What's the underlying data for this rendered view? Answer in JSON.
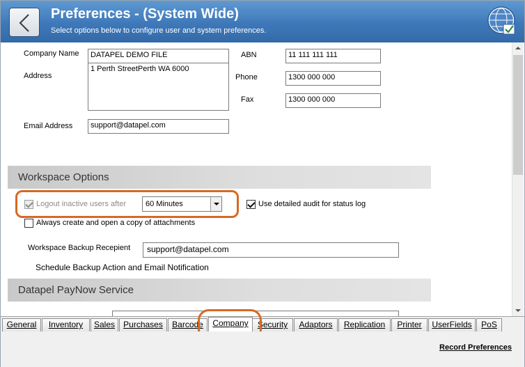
{
  "header": {
    "title": "Preferences - (System Wide)",
    "subtitle": "Select options below to configure user and system preferences."
  },
  "company": {
    "company_name_label": "Company Name",
    "company_name_value": "DATAPEL DEMO FILE",
    "address_label": "Address",
    "address_value": "1 Perth StreetPerth WA 6000",
    "email_label": "Email Address",
    "email_value": "support@datapel.com",
    "abn_label": "ABN",
    "abn_value": "11 111 111 111",
    "phone_label": "Phone",
    "phone_value": "1300 000 000",
    "fax_label": "Fax",
    "fax_value": "1300 000 000"
  },
  "workspace": {
    "section_title": "Workspace Options",
    "logout_label": "Logout inactive users after",
    "logout_checked": true,
    "logout_dropdown_value": "60 Minutes",
    "audit_label": "Use detailed audit for status log",
    "audit_checked": true,
    "attachments_label": "Always create and open a copy of attachments",
    "attachments_checked": false,
    "backup_recipient_label": "Workspace Backup Recepient",
    "backup_recipient_value": "support@datapel.com",
    "schedule_label": "Schedule Backup Action and Email Notification"
  },
  "paynow": {
    "section_title": "Datapel PayNow Service"
  },
  "tabs": [
    {
      "label": "General"
    },
    {
      "label": "Inventory"
    },
    {
      "label": "Sales"
    },
    {
      "label": "Purchases"
    },
    {
      "label": "Barcode"
    },
    {
      "label": "Company",
      "active": true
    },
    {
      "label": "Security"
    },
    {
      "label": "Adaptors"
    },
    {
      "label": "Replication"
    },
    {
      "label": "Printer"
    },
    {
      "label": "UserFields"
    },
    {
      "label": "PoS"
    }
  ],
  "footer": {
    "record_label": "Record Preferences"
  },
  "colors": {
    "header_blue": "#3f78b9",
    "highlight_orange": "#d56a22"
  }
}
